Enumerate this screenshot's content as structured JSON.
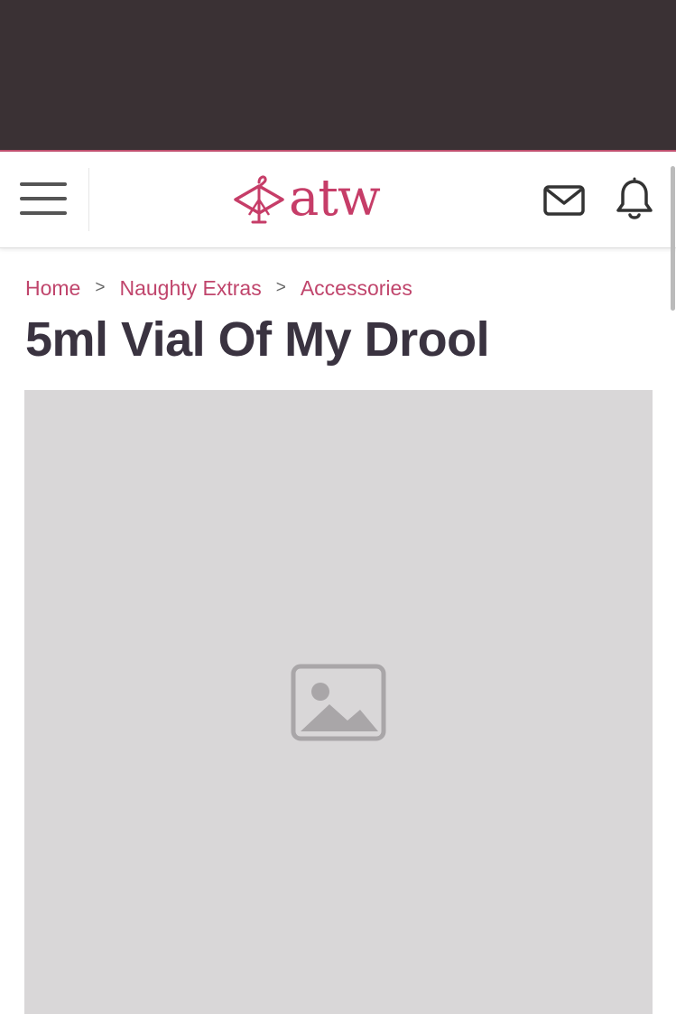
{
  "header": {
    "logo_text": "atw",
    "menu_icon": "hamburger-menu-icon",
    "mail_icon": "envelope-icon",
    "bell_icon": "bell-icon",
    "brand_color": "#c63d68",
    "top_bar_color": "#3a3134"
  },
  "breadcrumb": {
    "items": [
      {
        "label": "Home"
      },
      {
        "label": "Naughty Extras"
      },
      {
        "label": "Accessories"
      }
    ],
    "separator": ">"
  },
  "product": {
    "title": "5ml Vial Of My Drool"
  }
}
